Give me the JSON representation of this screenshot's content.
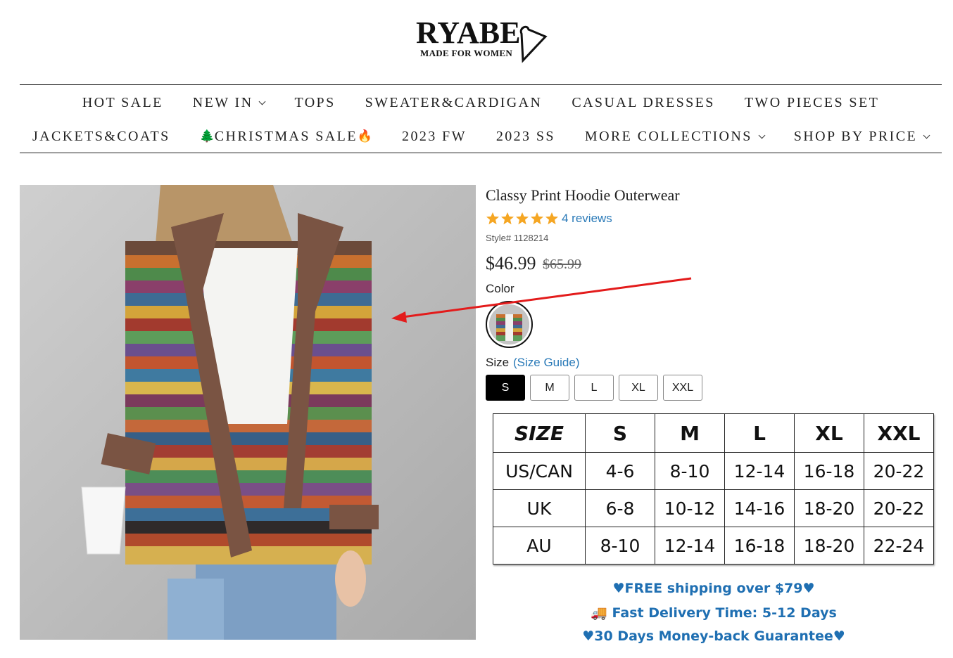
{
  "brand": {
    "name": "RYABE",
    "tagline": "MADE FOR WOMEN"
  },
  "nav": {
    "row1": [
      {
        "label": "HOT SALE",
        "dropdown": false
      },
      {
        "label": "NEW IN",
        "dropdown": true
      },
      {
        "label": "TOPS",
        "dropdown": false
      },
      {
        "label": "SWEATER&CARDIGAN",
        "dropdown": false
      },
      {
        "label": "CASUAL DRESSES",
        "dropdown": false
      },
      {
        "label": "TWO PIECES SET",
        "dropdown": false
      }
    ],
    "row2": [
      {
        "label": "JACKETS&COATS",
        "dropdown": false
      },
      {
        "label": "CHRISTMAS SALE",
        "prefix": "🌲",
        "suffix": "🔥",
        "dropdown": false
      },
      {
        "label": "2023 FW",
        "dropdown": false
      },
      {
        "label": "2023 SS",
        "dropdown": false
      },
      {
        "label": "MORE COLLECTIONS",
        "dropdown": true
      },
      {
        "label": "SHOP BY PRICE",
        "dropdown": true
      }
    ]
  },
  "product": {
    "title": "Classy Print Hoodie Outerwear",
    "rating": 5,
    "reviews": "4 reviews",
    "style": "Style# 1128214",
    "price": "$46.99",
    "compare_price": "$65.99",
    "color_label": "Color",
    "size_label": "Size",
    "size_guide": "(Size Guide)",
    "sizes": [
      "S",
      "M",
      "L",
      "XL",
      "XXL"
    ],
    "selected_size": "S"
  },
  "size_chart": {
    "header": [
      "SIZE",
      "S",
      "M",
      "L",
      "XL",
      "XXL"
    ],
    "rows": [
      [
        "US/CAN",
        "4-6",
        "8-10",
        "12-14",
        "16-18",
        "20-22"
      ],
      [
        "UK",
        "6-8",
        "10-12",
        "14-16",
        "18-20",
        "20-22"
      ],
      [
        "AU",
        "8-10",
        "12-14",
        "16-18",
        "18-20",
        "22-24"
      ]
    ]
  },
  "promos": {
    "shipping": "♥FREE shipping over $79♥",
    "delivery": "🚚 Fast Delivery Time: 5-12 Days",
    "guarantee": "♥30 Days Money-back Guarantee♥"
  },
  "colors": {
    "link": "#2a7ab8",
    "star": "#f5a623",
    "promo": "#1f6fb2",
    "annotation_arrow": "#e31b1b"
  }
}
